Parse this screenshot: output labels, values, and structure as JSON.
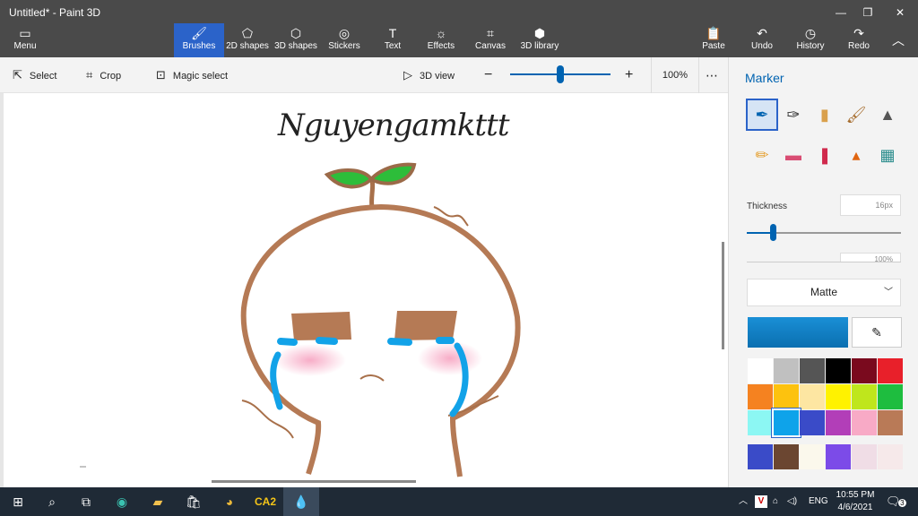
{
  "window": {
    "title": "Untitled* - Paint 3D",
    "minimize_icon": "minimize-icon",
    "maximize_icon": "maximize-icon",
    "close_icon": "close-icon"
  },
  "ribbon": {
    "menu_label": "Menu",
    "tools": [
      {
        "label": "Brushes",
        "icon": "brush-icon",
        "active": true
      },
      {
        "label": "2D shapes",
        "icon": "2d-shapes-icon"
      },
      {
        "label": "3D shapes",
        "icon": "3d-shapes-icon"
      },
      {
        "label": "Stickers",
        "icon": "stickers-icon"
      },
      {
        "label": "Text",
        "icon": "text-icon"
      },
      {
        "label": "Effects",
        "icon": "effects-icon"
      },
      {
        "label": "Canvas",
        "icon": "canvas-icon"
      },
      {
        "label": "3D library",
        "icon": "3d-library-icon"
      }
    ],
    "actions": [
      {
        "label": "Paste",
        "icon": "paste-icon"
      },
      {
        "label": "Undo",
        "icon": "undo-icon"
      },
      {
        "label": "History",
        "icon": "history-icon"
      },
      {
        "label": "Redo",
        "icon": "redo-icon"
      }
    ]
  },
  "commandbar": {
    "select_label": "Select",
    "crop_label": "Crop",
    "magic_select_label": "Magic select",
    "view3d_label": "3D view",
    "zoom_value": "100%",
    "zoom_level": 0.5,
    "more_icon": "more-icon"
  },
  "canvas": {
    "signature_text": "Nguyengamkttt"
  },
  "panel": {
    "title": "Marker",
    "brushes": [
      "marker-icon",
      "calligraphy-pen-icon",
      "oil-brush-icon",
      "watercolor-icon",
      "pixel-pen-icon",
      "pencil-icon",
      "eraser-icon",
      "crayon-icon",
      "spray-can-icon",
      "fill-icon"
    ],
    "thickness_label": "Thickness",
    "thickness_value": "16px",
    "thickness_level": 0.17,
    "opacity_value": "100%",
    "finish_value": "Matte",
    "current_color": "#1a8fd6",
    "palette": [
      "#ffffff",
      "#c0c0c0",
      "#555555",
      "#000000",
      "#7a0a1e",
      "#e8202a",
      "#f58220",
      "#fdc20e",
      "#fde6a2",
      "#fff200",
      "#bfe61c",
      "#1ebd3f",
      "#8cf7f3",
      "#0ea3ea",
      "#3a4bc8",
      "#b23eb8",
      "#f8aac6",
      "#b97a57"
    ],
    "custom_colors": [
      "#3a4bc8",
      "#6b4631",
      "#fbf8ec",
      "#7c4be8",
      "#f0dde6",
      "#f6e9ea"
    ]
  },
  "taskbar": {
    "time": "10:55 PM",
    "date": "4/6/2021",
    "language": "ENG",
    "notification_count": "3",
    "apps": [
      "start-icon",
      "search-icon",
      "task-view-icon",
      "edge-icon",
      "file-explorer-icon",
      "store-icon",
      "chrome-icon",
      "ca2-app",
      "paint3d-icon"
    ],
    "ca2_label": "CA2"
  }
}
